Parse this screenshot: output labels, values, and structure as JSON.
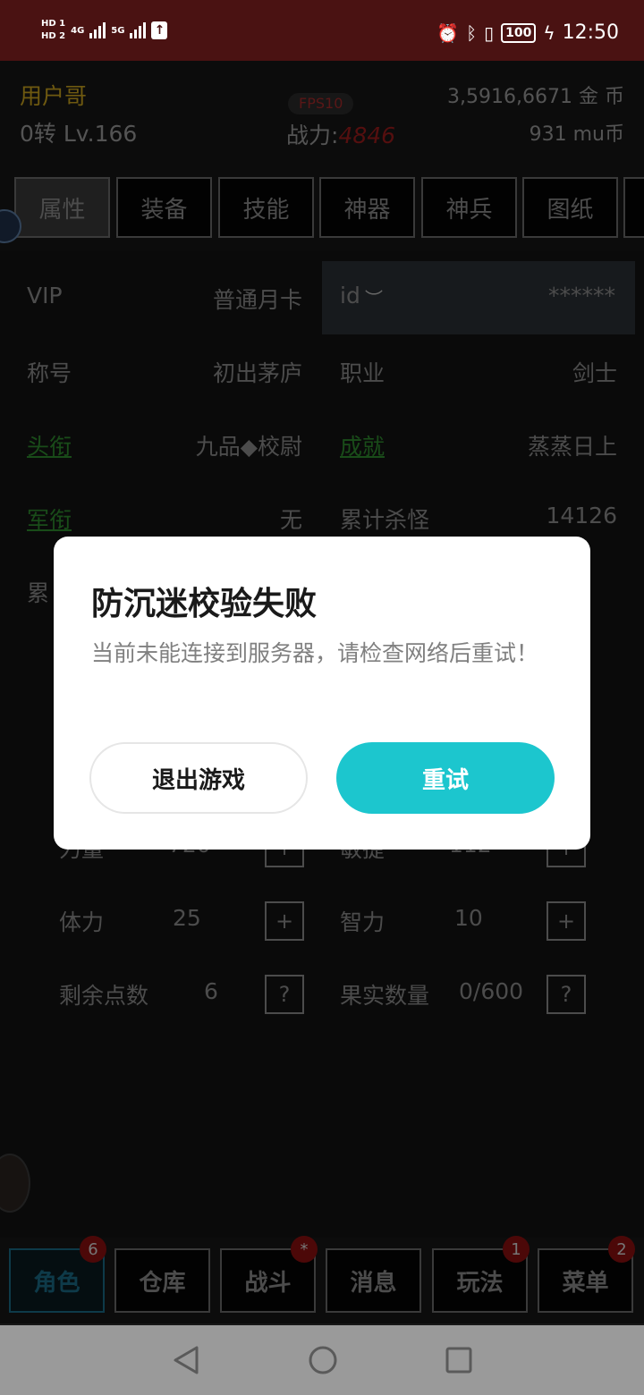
{
  "statusbar": {
    "hd1": "HD 1",
    "hd2": "HD 2",
    "net1": "4G",
    "net2": "5G",
    "battery": "100",
    "time": "12:50"
  },
  "header": {
    "username": "用户哥",
    "level": "0转 Lv.166",
    "fps": "FPS10",
    "power_label": "战力:",
    "power_value": "4846",
    "gold": "3,5916,6671 金 币",
    "mu": "931 mu币"
  },
  "tabs": [
    "属性",
    "装备",
    "技能",
    "神器",
    "神兵",
    "图纸"
  ],
  "attributes": {
    "vip_label": "VIP",
    "vip_value": "普通月卡",
    "id_label": "id",
    "id_value": "******",
    "title_label": "称号",
    "title_value": "初出茅庐",
    "job_label": "职业",
    "job_value": "剑士",
    "rank_label": "头衔",
    "rank_value": "九品◆校尉",
    "achieve_label": "成就",
    "achieve_value": "蒸蒸日上",
    "military_label": "军衔",
    "military_value": "无",
    "kills_label": "累计杀怪",
    "kills_value": "14126",
    "partial_label": "累",
    "strength_label": "力量",
    "strength_value": "720",
    "agility_label": "敏捷",
    "agility_value": "112",
    "stamina_label": "体力",
    "stamina_value": "25",
    "intel_label": "智力",
    "intel_value": "10",
    "points_label": "剩余点数",
    "points_value": "6",
    "fruit_label": "果实数量",
    "fruit_value": "0/600",
    "plus": "+",
    "question": "?"
  },
  "dialog": {
    "title": "防沉迷校验失败",
    "message": "当前未能连接到服务器，请检查网络后重试！",
    "exit_label": "退出游戏",
    "retry_label": "重试"
  },
  "bottom_nav": [
    {
      "label": "角色",
      "badge": "6"
    },
    {
      "label": "仓库",
      "badge": ""
    },
    {
      "label": "战斗",
      "badge": "*"
    },
    {
      "label": "消息",
      "badge": ""
    },
    {
      "label": "玩法",
      "badge": "1"
    },
    {
      "label": "菜单",
      "badge": "2"
    }
  ],
  "colors": {
    "statusbar": "#4a1212",
    "accent_retry": "#1cc6ce",
    "gold_name": "#c8a21e",
    "link_green": "#2f8a2f",
    "badge_red": "#8a1010"
  }
}
